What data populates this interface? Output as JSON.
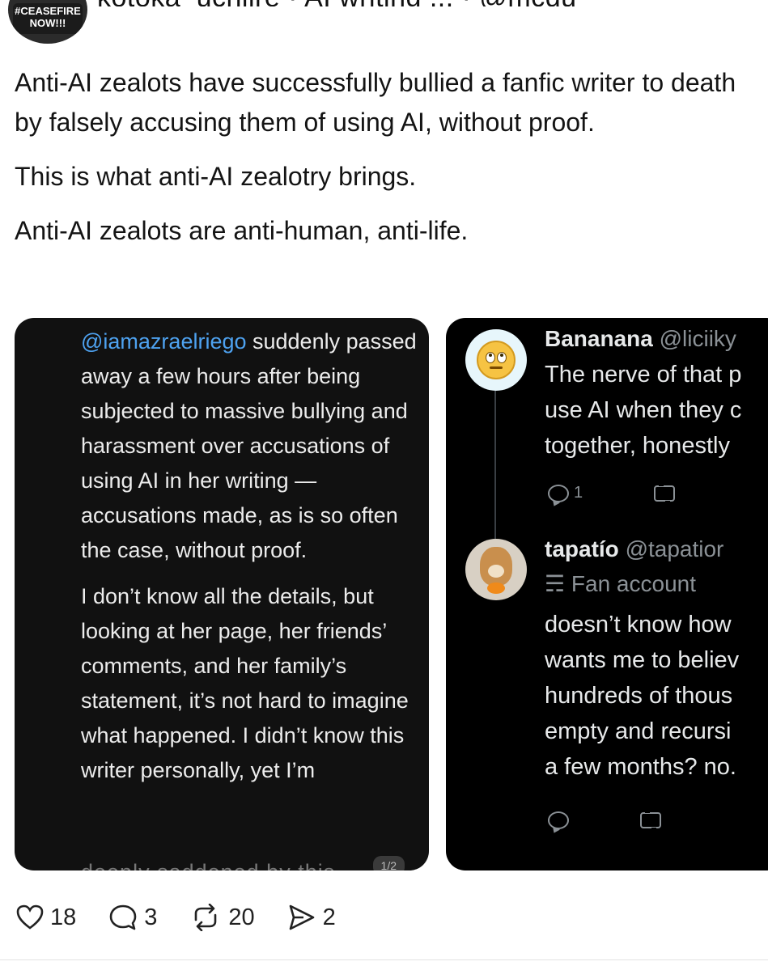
{
  "header": {
    "cutoff_text": "kotoka_uchijre · AI writing ... · @mcdu",
    "avatar_badge_line1": "#CEASEFIRE",
    "avatar_badge_line2": "NOW!!!"
  },
  "post": {
    "paragraphs": [
      "Anti-AI zealots have successfully bullied a fanfic writer to death by falsely accusing them of using AI, without proof.",
      "This is what anti-AI zealotry brings.",
      "Anti-AI zealots are anti-human, anti-life."
    ]
  },
  "media_left": {
    "mention": "@iamazraelriego",
    "para1_rest": " suddenly passed away a few hours after being subjected to massive bullying and harassment over accusations of using AI in her writing — accusations made, as is so often the case, without proof.",
    "para2": "I don’t know all the details, but looking at her page, her friends’ comments, and her family’s statement, it’s not hard to imagine what happened. I didn’t know this writer personally, yet I’m",
    "partial": "deeply saddened by this",
    "pager": "1/2"
  },
  "media_right": {
    "tweet1": {
      "name": "Bananana",
      "handle": "@liciiky",
      "lines": [
        "The nerve of that p",
        "use AI when they c",
        "together, honestly"
      ],
      "reply_count": "1"
    },
    "tweet2": {
      "name": "tapatío",
      "handle": "@tapatior",
      "fan_label": "Fan account",
      "lines": [
        "doesn’t know how",
        "wants me to believ",
        "hundreds of thous",
        "empty and recursi",
        "a few months? no."
      ]
    }
  },
  "footer": {
    "likes": "18",
    "replies": "3",
    "reposts": "20",
    "shares": "2"
  }
}
